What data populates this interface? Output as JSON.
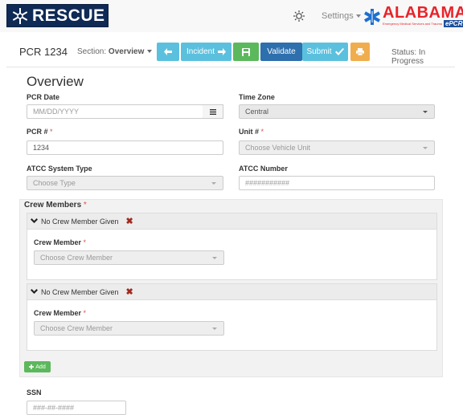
{
  "header": {
    "logo_text": "RESCUE",
    "settings_label": "Settings",
    "brand_name": "ALABAMA",
    "brand_sub": "Emergency Medical Services and Trauma",
    "brand_tag": "ePCR"
  },
  "toolbar": {
    "pcr_id": "PCR 1234",
    "section_prefix": "Section:",
    "section_value": "Overview",
    "incident_label": "Incident",
    "validate_label": "Validate",
    "submit_label": "Submit",
    "status_text": "Status: In Progress"
  },
  "form": {
    "title": "Overview",
    "pcr_date": {
      "label": "PCR Date",
      "placeholder": "MM/DD/YYYY"
    },
    "time_zone": {
      "label": "Time Zone",
      "value": "Central"
    },
    "pcr_number": {
      "label": "PCR #",
      "value": "1234"
    },
    "unit_number": {
      "label": "Unit #",
      "placeholder": "Choose Vehicle Unit"
    },
    "atcc_system_type": {
      "label": "ATCC System Type",
      "placeholder": "Choose Type"
    },
    "atcc_number": {
      "label": "ATCC Number",
      "placeholder": "###########"
    },
    "required_mark": "*"
  },
  "crew": {
    "title": "Crew Members",
    "members": [
      {
        "heading": "No Crew Member Given",
        "field_label": "Crew Member",
        "placeholder": "Choose Crew Member"
      },
      {
        "heading": "No Crew Member Given",
        "field_label": "Crew Member",
        "placeholder": "Choose Crew Member"
      }
    ],
    "add_label": "Add"
  },
  "ssn": {
    "label": "SSN",
    "placeholder": "###-##-####"
  },
  "colors": {
    "info": "#5bc0de",
    "success": "#5cb85c",
    "primary": "#2e6fad",
    "warning": "#f0ad4e",
    "logo_bg": "#0e2a55",
    "brand_red": "#e8232a"
  }
}
